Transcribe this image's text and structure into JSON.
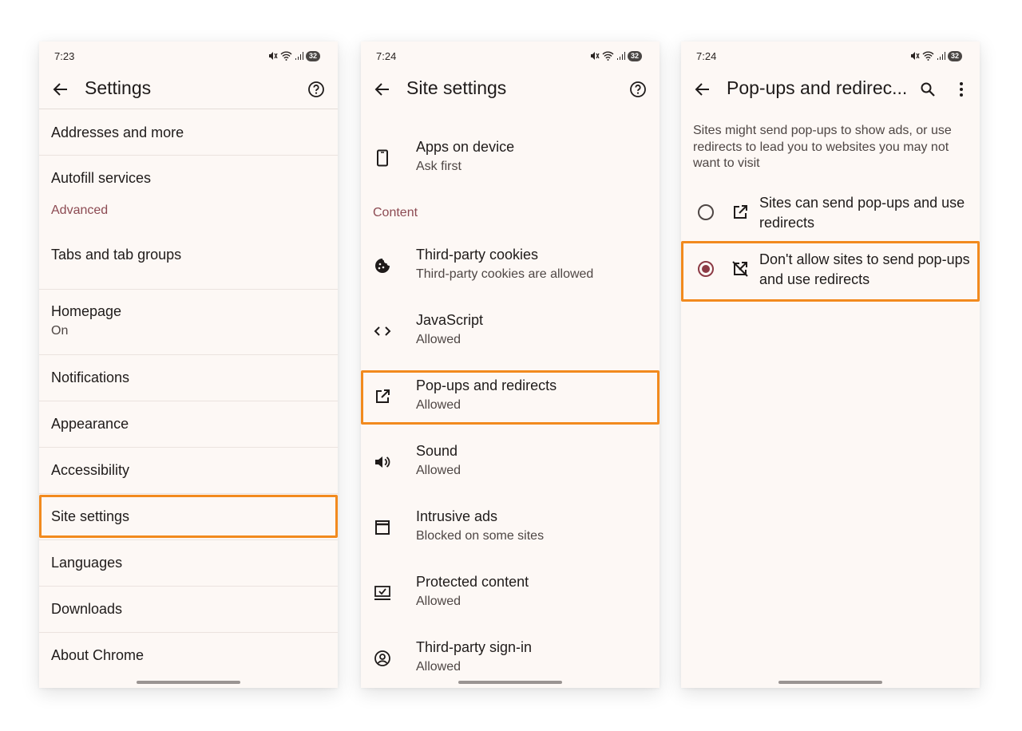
{
  "colors": {
    "highlight": "#f28a1e",
    "section_header": "#8c4a52",
    "radio_selected": "#8c3a44",
    "background": "#fdf8f5"
  },
  "screen1": {
    "time": "7:23",
    "battery": "32",
    "title": "Settings",
    "icons": [
      "back-arrow-icon",
      "help-icon"
    ],
    "items": [
      {
        "label": "Addresses and more"
      },
      {
        "label": "Autofill services"
      },
      {
        "section": "Advanced"
      },
      {
        "label": "Tabs and tab groups"
      },
      {
        "label": "Homepage",
        "sub": "On"
      },
      {
        "label": "Notifications"
      },
      {
        "label": "Appearance"
      },
      {
        "label": "Accessibility"
      },
      {
        "label": "Site settings",
        "highlighted": true
      },
      {
        "label": "Languages"
      },
      {
        "label": "Downloads"
      },
      {
        "label": "About Chrome"
      }
    ]
  },
  "screen2": {
    "time": "7:24",
    "battery": "32",
    "title": "Site settings",
    "icons": [
      "back-arrow-icon",
      "help-icon"
    ],
    "first_item": {
      "label": "Apps on device",
      "sub": "Ask first",
      "icon": "phone-icon"
    },
    "section": "Content",
    "items": [
      {
        "label": "Third-party cookies",
        "sub": "Third-party cookies are allowed",
        "icon": "cookie-icon"
      },
      {
        "label": "JavaScript",
        "sub": "Allowed",
        "icon": "code-icon"
      },
      {
        "label": "Pop-ups and redirects",
        "sub": "Allowed",
        "icon": "open-in-new-icon",
        "highlighted": true
      },
      {
        "label": "Sound",
        "sub": "Allowed",
        "icon": "volume-icon"
      },
      {
        "label": "Intrusive ads",
        "sub": "Blocked on some sites",
        "icon": "window-icon"
      },
      {
        "label": "Protected content",
        "sub": "Allowed",
        "icon": "protected-content-icon"
      },
      {
        "label": "Third-party sign-in",
        "sub": "Allowed",
        "icon": "account-circle-icon"
      }
    ]
  },
  "screen3": {
    "time": "7:24",
    "battery": "32",
    "title": "Pop-ups and redirec...",
    "icons": [
      "back-arrow-icon",
      "search-icon",
      "more-vert-icon"
    ],
    "description": "Sites might send pop-ups to show ads, or use redirects to lead you to websites you may not want to visit",
    "options": [
      {
        "label": "Sites can send pop-ups and use redirects",
        "selected": false,
        "icon": "open-in-new-icon"
      },
      {
        "label": "Don't allow sites to send pop-ups and use redirects",
        "selected": true,
        "icon": "open-in-new-off-icon",
        "highlighted": true
      }
    ]
  }
}
